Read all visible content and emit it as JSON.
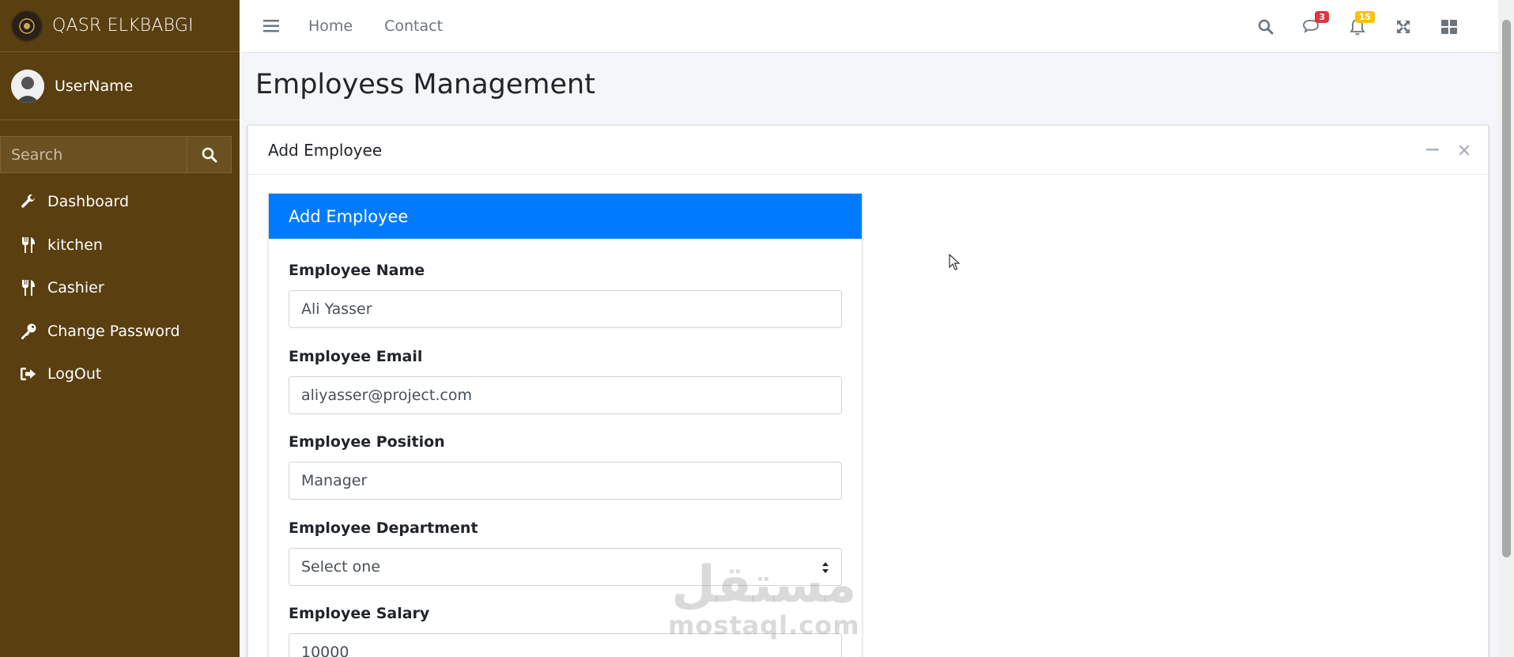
{
  "brand": {
    "name": "QASR ELKBABGI"
  },
  "user": {
    "name": "UserName"
  },
  "sidebar": {
    "search_placeholder": "Search",
    "items": [
      {
        "label": "Dashboard",
        "icon": "wrench-icon"
      },
      {
        "label": "kitchen",
        "icon": "utensils-icon"
      },
      {
        "label": "Cashier",
        "icon": "utensils-icon"
      },
      {
        "label": "Change Password",
        "icon": "key-icon"
      },
      {
        "label": "LogOut",
        "icon": "sign-out-icon"
      }
    ]
  },
  "topbar": {
    "links": [
      "Home",
      "Contact"
    ],
    "messages_badge": "3",
    "notifications_badge": "15"
  },
  "page": {
    "title": "Employess Management"
  },
  "card": {
    "title": "Add Employee"
  },
  "form": {
    "title": "Add Employee",
    "fields": [
      {
        "label": "Employee Name",
        "value": "Ali Yasser"
      },
      {
        "label": "Employee Email",
        "value": "aliyasser@project.com"
      },
      {
        "label": "Employee Position",
        "value": "Manager"
      },
      {
        "label": "Employee Department",
        "value": "Select one"
      },
      {
        "label": "Employee Salary",
        "value": "10000"
      }
    ]
  },
  "watermark": {
    "arabic": "مستقل",
    "latin": "mostaql.com"
  },
  "colors": {
    "sidebar": "#5a3f11",
    "primary": "#007bff",
    "badge_red": "#dc3545",
    "badge_yellow": "#ffc107"
  }
}
